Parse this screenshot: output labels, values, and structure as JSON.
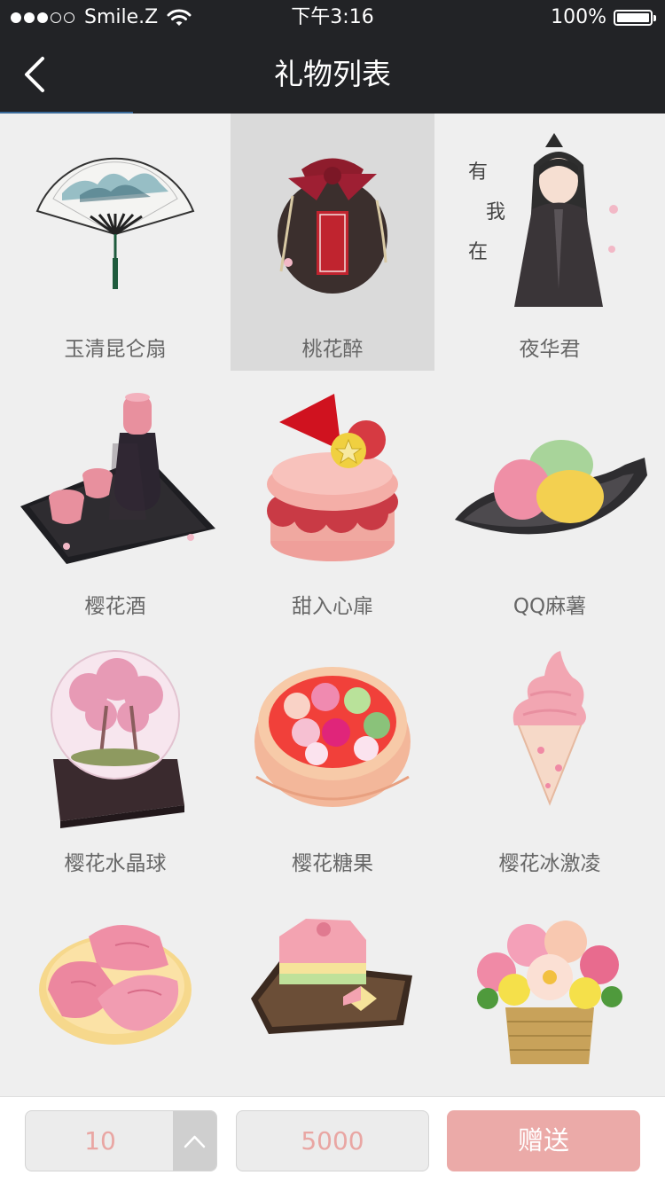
{
  "status_bar": {
    "carrier": "Smile.Z",
    "time": "下午3:16",
    "battery": "100%"
  },
  "nav": {
    "title": "礼物列表",
    "back_icon": "chevron-left-icon"
  },
  "gifts": [
    {
      "name": "玉清昆仑扇",
      "icon": "folding-fan-icon",
      "selected": false
    },
    {
      "name": "桃花醉",
      "icon": "wine-jar-icon",
      "selected": true
    },
    {
      "name": "夜华君",
      "icon": "character-figure-icon",
      "selected": false
    },
    {
      "name": "樱花酒",
      "icon": "sake-set-icon",
      "selected": false
    },
    {
      "name": "甜入心扉",
      "icon": "macaron-icon",
      "selected": false
    },
    {
      "name": "QQ麻薯",
      "icon": "mochi-plate-icon",
      "selected": false
    },
    {
      "name": "樱花水晶球",
      "icon": "snow-globe-icon",
      "selected": false
    },
    {
      "name": "樱花糖果",
      "icon": "candy-box-icon",
      "selected": false
    },
    {
      "name": "樱花冰激凌",
      "icon": "ice-cream-cone-icon",
      "selected": false
    },
    {
      "name": "",
      "icon": "taiyaki-plate-icon",
      "selected": false
    },
    {
      "name": "",
      "icon": "layer-cake-icon",
      "selected": false
    },
    {
      "name": "",
      "icon": "flower-basket-icon",
      "selected": false
    }
  ],
  "footer": {
    "quantity": "10",
    "quantity_up_icon": "chevron-up-icon",
    "price": "5000",
    "send_label": "赠送"
  }
}
